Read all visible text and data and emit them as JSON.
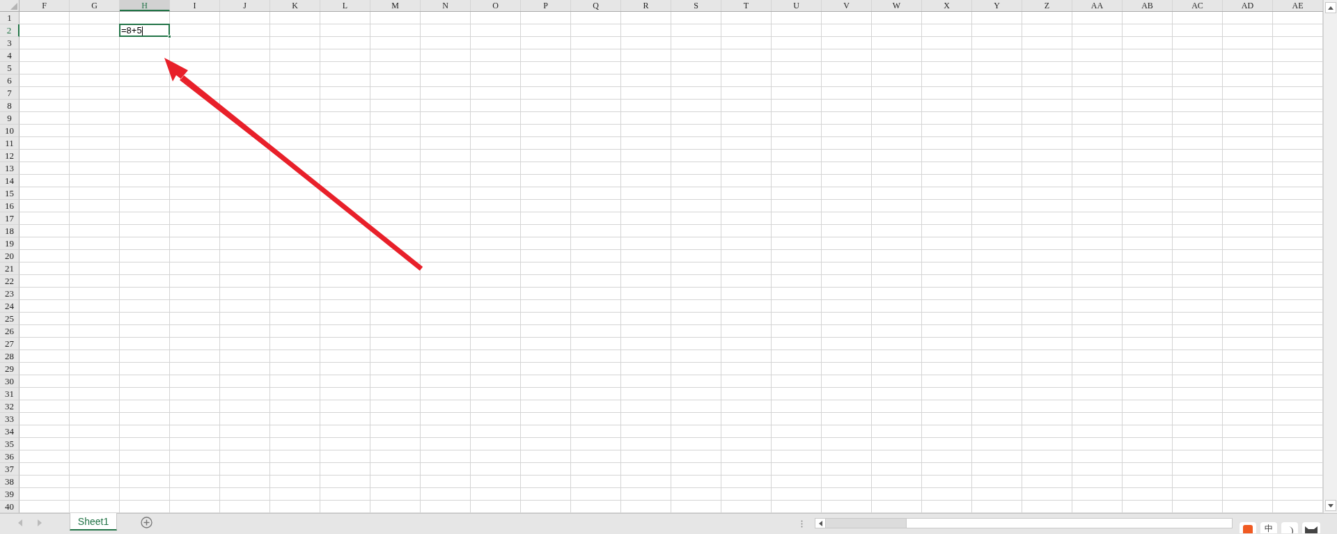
{
  "columns": [
    {
      "label": "F",
      "selected": false
    },
    {
      "label": "G",
      "selected": false
    },
    {
      "label": "H",
      "selected": true
    },
    {
      "label": "I",
      "selected": false
    },
    {
      "label": "J",
      "selected": false
    },
    {
      "label": "K",
      "selected": false
    },
    {
      "label": "L",
      "selected": false
    },
    {
      "label": "M",
      "selected": false
    },
    {
      "label": "N",
      "selected": false
    },
    {
      "label": "O",
      "selected": false
    },
    {
      "label": "P",
      "selected": false
    },
    {
      "label": "Q",
      "selected": false
    },
    {
      "label": "R",
      "selected": false
    },
    {
      "label": "S",
      "selected": false
    },
    {
      "label": "T",
      "selected": false
    },
    {
      "label": "U",
      "selected": false
    },
    {
      "label": "V",
      "selected": false
    },
    {
      "label": "W",
      "selected": false
    },
    {
      "label": "X",
      "selected": false
    },
    {
      "label": "Y",
      "selected": false
    },
    {
      "label": "Z",
      "selected": false
    },
    {
      "label": "AA",
      "selected": false
    },
    {
      "label": "AB",
      "selected": false
    },
    {
      "label": "AC",
      "selected": false
    },
    {
      "label": "AD",
      "selected": false
    },
    {
      "label": "AE",
      "selected": false
    }
  ],
  "rows": [
    {
      "label": "1",
      "selected": false
    },
    {
      "label": "2",
      "selected": true
    },
    {
      "label": "3",
      "selected": false
    },
    {
      "label": "4",
      "selected": false
    },
    {
      "label": "5",
      "selected": false
    },
    {
      "label": "6",
      "selected": false
    },
    {
      "label": "7",
      "selected": false
    },
    {
      "label": "8",
      "selected": false
    },
    {
      "label": "9",
      "selected": false
    },
    {
      "label": "10",
      "selected": false
    },
    {
      "label": "11",
      "selected": false
    },
    {
      "label": "12",
      "selected": false
    },
    {
      "label": "13",
      "selected": false
    },
    {
      "label": "14",
      "selected": false
    },
    {
      "label": "15",
      "selected": false
    },
    {
      "label": "16",
      "selected": false
    },
    {
      "label": "17",
      "selected": false
    },
    {
      "label": "18",
      "selected": false
    },
    {
      "label": "19",
      "selected": false
    },
    {
      "label": "20",
      "selected": false
    },
    {
      "label": "21",
      "selected": false
    },
    {
      "label": "22",
      "selected": false
    },
    {
      "label": "23",
      "selected": false
    },
    {
      "label": "24",
      "selected": false
    },
    {
      "label": "25",
      "selected": false
    },
    {
      "label": "26",
      "selected": false
    },
    {
      "label": "27",
      "selected": false
    },
    {
      "label": "28",
      "selected": false
    },
    {
      "label": "29",
      "selected": false
    },
    {
      "label": "30",
      "selected": false
    },
    {
      "label": "31",
      "selected": false
    },
    {
      "label": "32",
      "selected": false
    },
    {
      "label": "33",
      "selected": false
    },
    {
      "label": "34",
      "selected": false
    },
    {
      "label": "35",
      "selected": false
    },
    {
      "label": "36",
      "selected": false
    },
    {
      "label": "37",
      "selected": false
    },
    {
      "label": "38",
      "selected": false
    },
    {
      "label": "39",
      "selected": false
    },
    {
      "label": "40",
      "selected": false
    }
  ],
  "active_cell": {
    "value": "=8+5"
  },
  "sheet_tabs": [
    {
      "label": "Sheet1",
      "selected": true
    }
  ],
  "ime_toolbar": {
    "mode": "中"
  }
}
